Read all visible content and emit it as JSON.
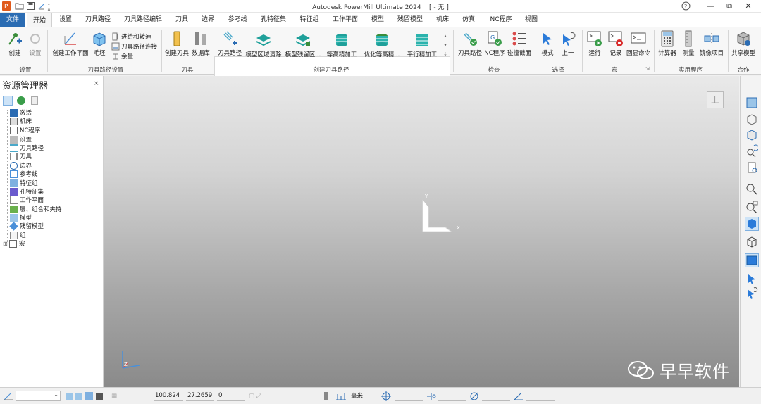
{
  "titlebar": {
    "title": "Autodesk PowerMill Ultimate 2024",
    "doc": "[ - 无 ]",
    "help_icon": "help-icon",
    "minimize": "—",
    "restore": "⧉",
    "close": "✕"
  },
  "tabs": [
    "文件",
    "开始",
    "设置",
    "刀具路径",
    "刀具路径编辑",
    "刀具",
    "边界",
    "参考线",
    "孔特征集",
    "特征组",
    "工作平面",
    "模型",
    "残留模型",
    "机床",
    "仿真",
    "NC程序",
    "视图"
  ],
  "ribbon": {
    "setup": {
      "create": "创建",
      "settings": "设置",
      "group": "设置"
    },
    "toolpath_setup": {
      "create_workplane": "创建工作平面",
      "block": "毛坯",
      "feeds": "进给和转速",
      "connections": "刀具路径连接",
      "allowance": "余量",
      "group": "刀具路径设置"
    },
    "tool": {
      "create_tool": "创建刀具",
      "database": "数据库",
      "group": "刀具"
    },
    "create_toolpaths": {
      "toolpath": "刀具路径",
      "items": [
        "模型区域清除",
        "模型残留区...",
        "等高精加工",
        "优化等高精...",
        "平行精加工"
      ],
      "group": "创建刀具路径"
    },
    "check": {
      "toolpath": "刀具路径",
      "ncprogram": "NC程序",
      "collision": "碰撞截面",
      "group": "检查"
    },
    "select": {
      "mode": "模式",
      "previous": "上一",
      "group": "选择"
    },
    "macro": {
      "run": "运行",
      "record": "记录",
      "echo": "回显命令",
      "group": "宏"
    },
    "utilities": {
      "calculator": "计算器",
      "measure": "测量",
      "mirror": "镜像项目",
      "group": "实用程序"
    },
    "collab": {
      "share": "共享模型",
      "group": "合作"
    }
  },
  "explorer": {
    "title": "资源管理器",
    "close": "×",
    "items": [
      "激活",
      "机床",
      "NC程序",
      "设置",
      "刀具路径",
      "刀具",
      "边界",
      "参考线",
      "特征组",
      "孔特征集",
      "工作平面",
      "层、组合和夹持",
      "模型",
      "残留模型",
      "组",
      "宏"
    ]
  },
  "viewport": {
    "axis_x": "X",
    "axis_y": "Y",
    "axis_z": "Z",
    "view_button": "上"
  },
  "status": {
    "x": "100.824",
    "y": "27.2659",
    "z": "0",
    "units": "毫米"
  },
  "watermark": {
    "text": "早早软件"
  }
}
